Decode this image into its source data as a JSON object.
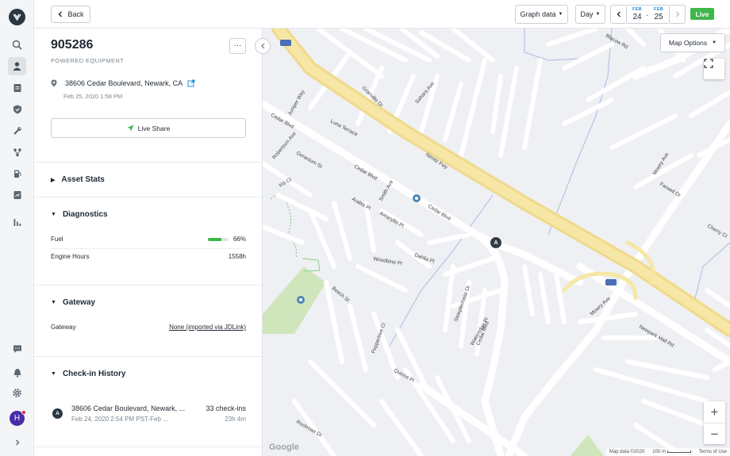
{
  "nav": {
    "items": [
      "logo",
      "search",
      "fleet",
      "documents",
      "safety",
      "maintenance",
      "routing",
      "fuel",
      "reports",
      "analytics"
    ],
    "bottom": [
      "messages",
      "alerts",
      "settings"
    ],
    "user_initial": "H"
  },
  "topbar": {
    "back_label": "Back",
    "graph_label": "Graph data",
    "range_label": "Day",
    "date_start_month": "FEB",
    "date_start_day": "24",
    "date_end_month": "FEB",
    "date_end_day": "25",
    "live_label": "Live"
  },
  "asset": {
    "name": "905286",
    "type": "POWERED EQUIPMENT",
    "address": "38606 Cedar Boulevard, Newark, CA",
    "timestamp": "Feb 25, 2020 1:58 PM",
    "live_share_label": "Live Share"
  },
  "sections": {
    "asset_stats": "Asset Stats",
    "diagnostics": "Diagnostics",
    "gateway": "Gateway",
    "checkin_history": "Check-in History"
  },
  "diagnostics": {
    "fuel_label": "Fuel",
    "fuel_value": "66%",
    "fuel_level": 0.66,
    "engine_label": "Engine Hours",
    "engine_value": "1558h"
  },
  "gateway": {
    "label": "Gateway",
    "value": "None (imported via JDLink)"
  },
  "checkin": {
    "badge": "A",
    "address": "38606 Cedar Boulevard, Newark, ...",
    "time": "Feb 24, 2020 2:54 PM PST-Feb ...",
    "count": "33 check-ins",
    "duration": "23h 4m"
  },
  "map": {
    "options_label": "Map Options",
    "pin_label": "A",
    "google_label": "Google",
    "attribution_data": "Map data ©2020",
    "scale": "100 m",
    "terms": "Terms of Use",
    "streets": {
      "cedar_blvd": "Cedar Blvd",
      "nimitz": "Nimitz Fwy",
      "mowry": "Mowry Ave",
      "lake_way": "Juniper Way",
      "luna": "Luna Terrace",
      "smith": "Smith Ave",
      "amaryllis": "Amaryllis Pl",
      "woodbine": "Woodbine Pl",
      "dahlia": "Dahlia Pl",
      "beech": "Beech St",
      "peppertree": "Peppertree Ct",
      "blacow": "Blacow Rd",
      "newpark": "Newpark Mall Rd",
      "farwell": "Farwell Dr",
      "cherry": "Cherry Ct",
      "robertson": "Robertson Ave",
      "geranium": "Geranium St",
      "iris": "Iris Ct",
      "arabis": "Arabis Pl",
      "rockrose": "Rockrose Dr",
      "quince": "Quince Pl",
      "sahara": "Sahara Ave",
      "granville": "Granville Dr",
      "wateredge": "Wateredge Pl",
      "steeplechase": "Steeplechase Dr"
    }
  },
  "colors": {
    "live": "#3fb84a",
    "accent": "#1c8cd4",
    "fuel": "#3fb84a",
    "freeway": "#f6e7a6",
    "park": "#cfe6bd"
  }
}
